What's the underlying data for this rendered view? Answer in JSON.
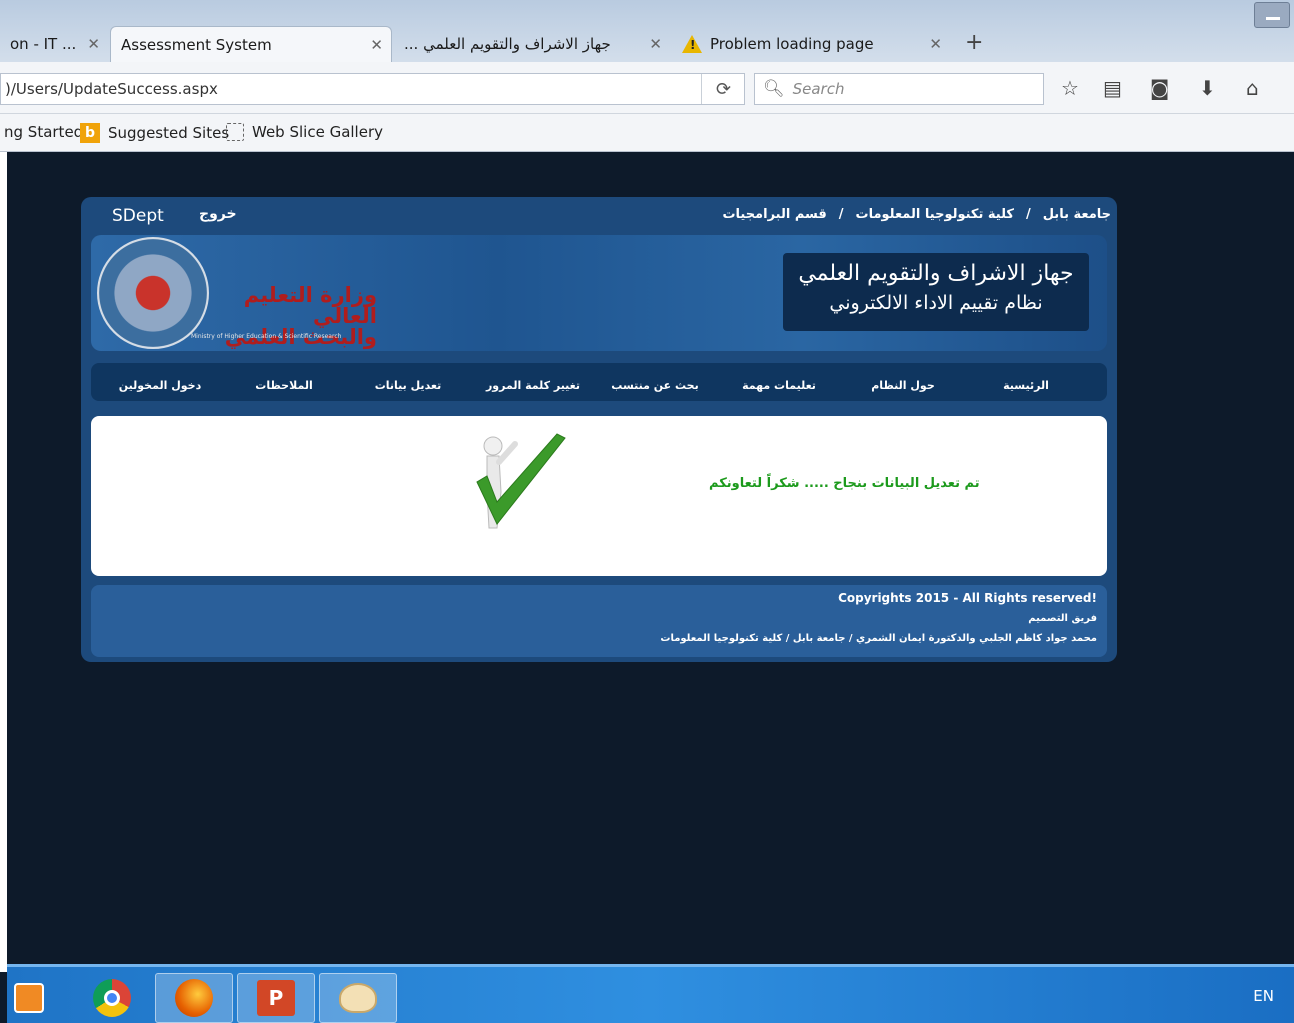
{
  "browser": {
    "tabs": [
      {
        "label": "on - IT ..."
      },
      {
        "label": "Assessment System"
      },
      {
        "label": "... جهاز الاشراف والتقويم العلمي"
      },
      {
        "label": "Problem loading page"
      }
    ],
    "url": ")/Users/UpdateSuccess.aspx",
    "search_placeholder": "Search",
    "bookmarks": [
      "ng Started",
      "Suggested Sites",
      "Web Slice Gallery"
    ],
    "bing_glyph": "b"
  },
  "site": {
    "user": "SDept",
    "logout": "خروج",
    "breadcrumb": [
      "جامعة بابل",
      "/",
      "كلية تكنولوجيا المعلومات",
      "/",
      "قسم البرامجيات"
    ],
    "ministry_line1": "وزارة التعليم العالي",
    "ministry_line2": "والبحث العلمي",
    "ministry_en": "Ministry of Higher Education & Scientific Research",
    "title_main": "جهاز الاشراف والتقويم العلمي",
    "title_sub": "نظام تقييم الاداء الالكتروني",
    "menu": [
      "الرئيسية",
      "حول النظام",
      "تعليمات مهمة",
      "بحث عن منتسب",
      "تغيير كلمة المرور",
      "تعديل بيانات",
      "الملاحظات",
      "دخول المخولين"
    ],
    "success_message": "تم تعديل البيانات بنجاح ..... شكراً لتعاونكم",
    "footer": {
      "copyright": "Copyrights 2015 - All Rights reserved!",
      "team_label": "فريق التصميم",
      "team": "محمد جواد كاظم الجلبي والدكتورة ايمان الشمري / جامعة بابل / كلية تكنولوجيا المعلومات"
    }
  },
  "taskbar": {
    "apps": [
      "media-player-icon",
      "chrome-icon",
      "firefox-icon",
      "powerpoint-icon",
      "paint-icon"
    ],
    "powerpoint_glyph": "P",
    "language": "EN"
  },
  "colors": {
    "page_bg": "#0d1a2a",
    "frame": "#1d4a7c",
    "success_green": "#1c9a1c",
    "taskbar": "#2f8fe0"
  }
}
